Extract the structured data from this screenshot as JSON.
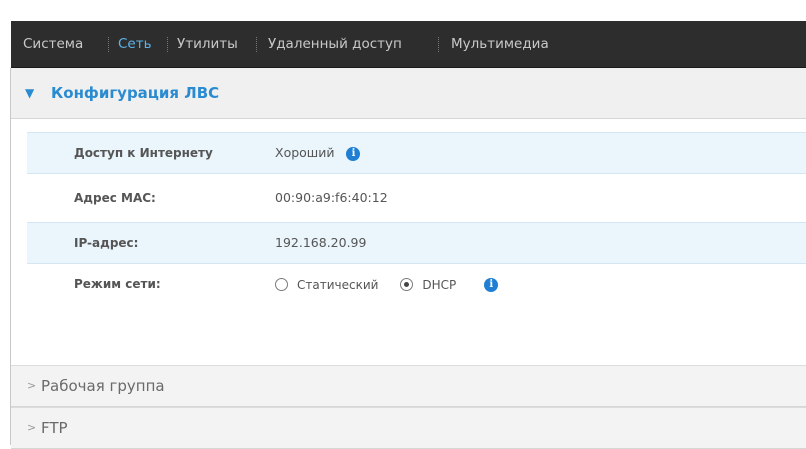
{
  "nav": {
    "items": [
      {
        "label": "Система",
        "active": false
      },
      {
        "label": "Сеть",
        "active": true
      },
      {
        "label": "Утилиты",
        "active": false
      },
      {
        "label": "Удаленный доступ",
        "active": false
      },
      {
        "label": "Мультимедиа",
        "active": false
      }
    ]
  },
  "lan_section": {
    "title": "Конфигурация ЛВС",
    "expanded": true,
    "rows": {
      "internet": {
        "label": "Доступ к Интернету",
        "value": "Хороший",
        "icon": "info-icon"
      },
      "mac": {
        "label": "Адрес MAC:",
        "value": "00:90:a9:f6:40:12"
      },
      "ip": {
        "label": "IP-адрес:",
        "value": "192.168.20.99"
      },
      "mode": {
        "label": "Режим сети:",
        "options": [
          {
            "label": "Статический",
            "selected": false
          },
          {
            "label": "DHCP",
            "selected": true
          }
        ],
        "icon": "info-icon"
      }
    }
  },
  "workgroup_section": {
    "title": "Рабочая группа",
    "expanded": false
  },
  "ftp_section": {
    "title": "FTP",
    "expanded": false
  },
  "colors": {
    "nav_bg": "#2d2d2d",
    "nav_active": "#5cb3e8",
    "accent": "#2a8bd0",
    "row_highlight": "#eaf5fc",
    "info_icon": "#1f7fd3"
  }
}
